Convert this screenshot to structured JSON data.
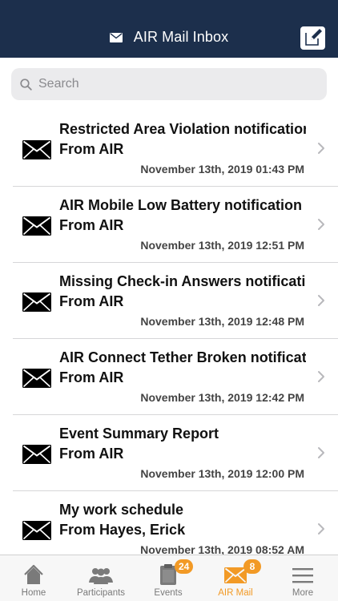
{
  "header": {
    "title": "AIR Mail Inbox",
    "icon": "envelope-icon",
    "compose_icon": "compose-icon",
    "background": "#1c2f4c"
  },
  "search": {
    "placeholder": "Search",
    "value": ""
  },
  "messages": [
    {
      "subject": "Restricted Area Violation notification",
      "from": "From AIR",
      "date": "November 13th, 2019 01:43 PM"
    },
    {
      "subject": "AIR Mobile Low Battery notification",
      "from": "From AIR",
      "date": "November 13th, 2019 12:51 PM"
    },
    {
      "subject": "Missing Check-in Answers notification",
      "from": "From AIR",
      "date": "November 13th, 2019 12:48 PM"
    },
    {
      "subject": "AIR Connect Tether Broken notification",
      "from": "From AIR",
      "date": "November 13th, 2019 12:42 PM"
    },
    {
      "subject": "Event Summary Report",
      "from": "From AIR",
      "date": "November 13th, 2019 12:00 PM"
    },
    {
      "subject": "My work schedule",
      "from": "From Hayes, Erick",
      "date": "November 13th, 2019 08:52 AM"
    }
  ],
  "tabs": [
    {
      "label": "Home",
      "icon": "home-icon",
      "badge": ""
    },
    {
      "label": "Participants",
      "icon": "participants-icon",
      "badge": ""
    },
    {
      "label": "Events",
      "icon": "events-icon",
      "badge": "24"
    },
    {
      "label": "AIR Mail",
      "icon": "mail-icon",
      "badge": "8",
      "active": true
    },
    {
      "label": "More",
      "icon": "menu-icon",
      "badge": ""
    }
  ],
  "colors": {
    "accent": "#f29a26",
    "inactive_tab": "#7a7a7a"
  }
}
